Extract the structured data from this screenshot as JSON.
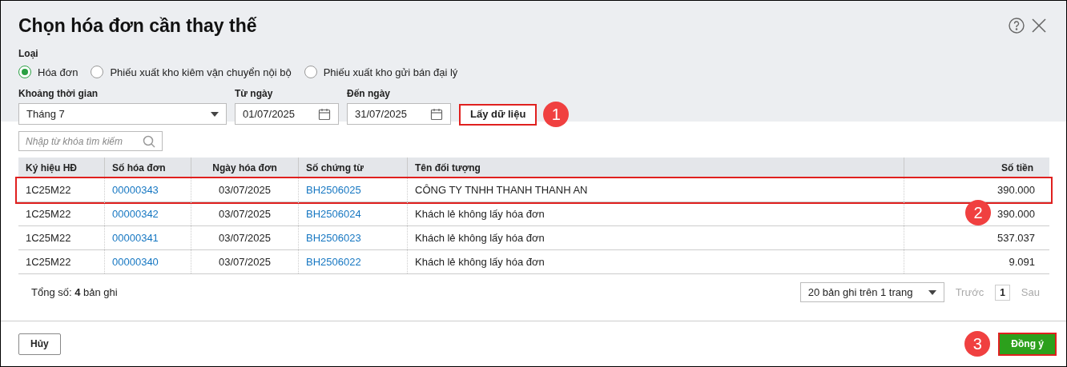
{
  "window": {
    "title": "Chọn hóa đơn cần thay thế"
  },
  "type_group": {
    "label": "Loại",
    "options": [
      {
        "label": "Hóa đơn",
        "selected": true
      },
      {
        "label": "Phiếu xuất kho kiêm vận chuyển nội bộ",
        "selected": false
      },
      {
        "label": "Phiếu xuất kho gửi bán đại lý",
        "selected": false
      }
    ]
  },
  "filters": {
    "period": {
      "label": "Khoảng thời gian",
      "value": "Tháng 7"
    },
    "from": {
      "label": "Từ ngày",
      "value": "01/07/2025"
    },
    "to": {
      "label": "Đến ngày",
      "value": "31/07/2025"
    },
    "fetch_button": {
      "label": "Lấy dữ liệu",
      "highlighted": true,
      "callout": "1"
    }
  },
  "search": {
    "placeholder": "Nhập từ khóa tìm kiếm"
  },
  "table": {
    "columns": [
      {
        "label": "Ký hiệu HĐ",
        "kind": "text"
      },
      {
        "label": "Số hóa đơn",
        "kind": "link"
      },
      {
        "label": "Ngày hóa đơn",
        "kind": "text"
      },
      {
        "label": "Số chứng từ",
        "kind": "link"
      },
      {
        "label": "Tên đối tượng",
        "kind": "text"
      },
      {
        "label": "Số tiền",
        "kind": "text"
      }
    ],
    "rows": [
      {
        "cells": [
          "1C25M22",
          "00000343",
          "03/07/2025",
          "BH2506025",
          "CÔNG TY TNHH THANH THANH AN",
          "390.000"
        ],
        "highlighted": true
      },
      {
        "cells": [
          "1C25M22",
          "00000342",
          "03/07/2025",
          "BH2506024",
          "Khách lẻ không lấy hóa đơn",
          "390.000"
        ],
        "highlighted": false,
        "callout": "2"
      },
      {
        "cells": [
          "1C25M22",
          "00000341",
          "03/07/2025",
          "BH2506023",
          "Khách lẻ không lấy hóa đơn",
          "537.037"
        ],
        "highlighted": false
      },
      {
        "cells": [
          "1C25M22",
          "00000340",
          "03/07/2025",
          "BH2506022",
          "Khách lẻ không lấy hóa đơn",
          "9.091"
        ],
        "highlighted": false
      }
    ]
  },
  "total": "Tổng số: **4** bản ghi",
  "pager": {
    "page_size": "20 bản ghi trên 1 trang",
    "prev": {
      "label": "Trước",
      "disabled": true
    },
    "pages": [
      {
        "label": "1",
        "selected": true
      }
    ],
    "next": {
      "label": "Sau",
      "disabled": true
    }
  },
  "footer": {
    "cancel": {
      "label": "Hủy"
    },
    "confirm": {
      "label": "Đồng ý",
      "highlighted": true,
      "callout": "3"
    }
  }
}
